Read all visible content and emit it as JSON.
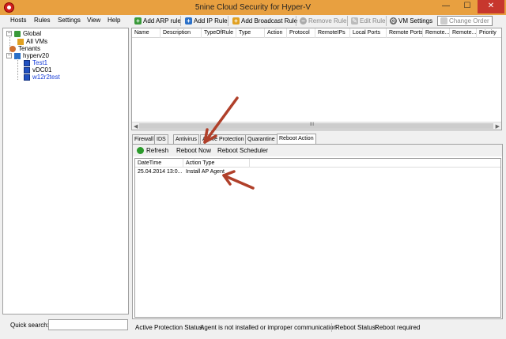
{
  "window": {
    "title": "5nine Cloud Security for Hyper-V",
    "minimize_glyph": "—",
    "maximize_glyph": "☐",
    "close_glyph": "✕"
  },
  "menu": [
    "Hosts",
    "Rules",
    "Settings",
    "View",
    "Help"
  ],
  "toolbar": {
    "add_arp_rule": "Add ARP rule",
    "add_ip_rule": "Add IP Rule",
    "add_broadcast_rule": "Add Broadcast Rule",
    "remove_rule": "Remove Rule",
    "edit_rule": "Edit Rule",
    "vm_settings": "VM Settings",
    "change_order": "Change Order"
  },
  "tree": {
    "global": "Global",
    "all_vms": "All VMs",
    "tenants": "Tenants",
    "host": "hyperv20",
    "vms": [
      "Test1",
      "vDC01",
      "w12r2test"
    ]
  },
  "quick_search": {
    "label": "Quick search:",
    "value": ""
  },
  "rules_grid": {
    "columns": [
      "Name",
      "Description",
      "TypeOfRule",
      "Type",
      "Action",
      "Protocol",
      "RemoteIPs",
      "Local Ports",
      "Remote Ports",
      "Remote...",
      "Remote...",
      "Priority"
    ],
    "grip": "III"
  },
  "tabs": [
    "Firewall",
    "IDS",
    "Antivirus",
    "Active Protection",
    "Quarantine",
    "Reboot Action"
  ],
  "active_tab": "Reboot Action",
  "reboot_panel": {
    "refresh": "Refresh",
    "reboot_now": "Reboot Now",
    "reboot_scheduler": "Reboot Scheduler",
    "columns": [
      "DateTime",
      "Action Type"
    ],
    "rows": [
      {
        "datetime": "25.04.2014 13:0...",
        "action_type": "Install AP Agent"
      }
    ]
  },
  "status": {
    "ap_label": "Active Protection Status:",
    "ap_value": "Agent is not installed or improper communication",
    "reboot_label": "Reboot Status:",
    "reboot_value": "Reboot required"
  },
  "colors": {
    "titlebar": "#e8a040",
    "close_button": "#c7372d",
    "vm_link": "#1a3fd8",
    "annotation_arrow": "#b0402a"
  },
  "icons": {
    "app": "shield-icon",
    "add": "plus-icon",
    "remove": "remove-icon",
    "edit": "pencil-icon",
    "vm_settings": "gear-icon",
    "refresh": "refresh-icon"
  }
}
